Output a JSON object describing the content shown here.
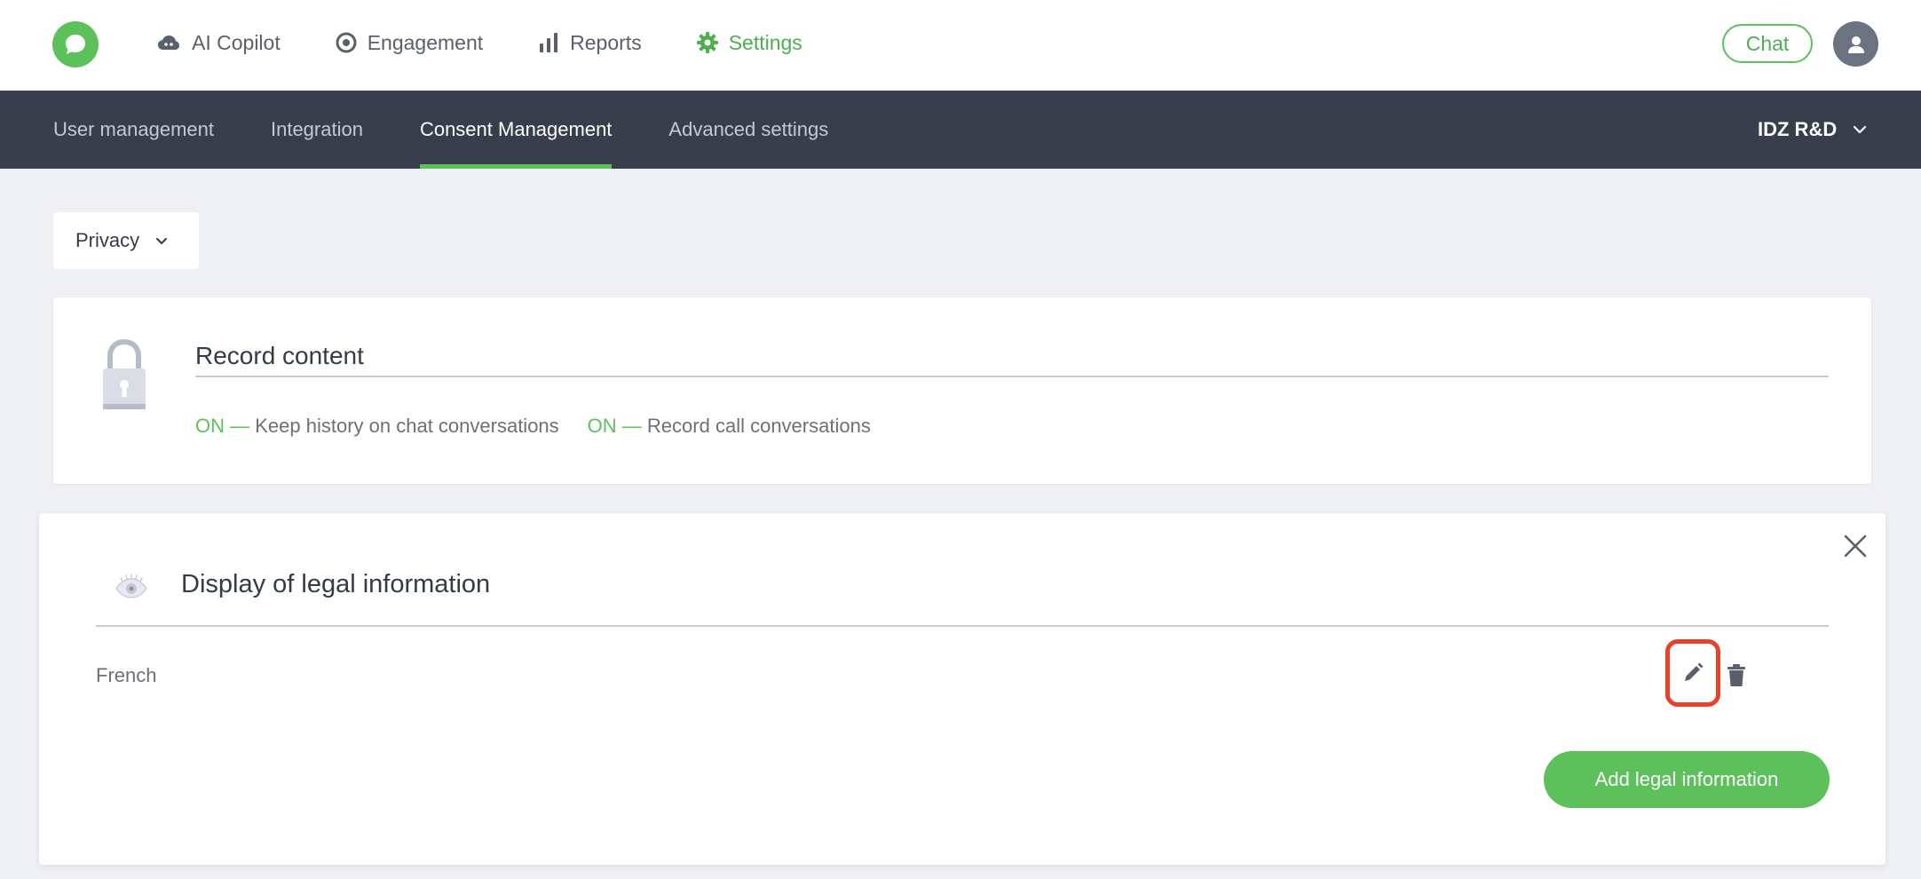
{
  "topnav": {
    "items": [
      {
        "label": "AI Copilot",
        "icon": "cloud-icon"
      },
      {
        "label": "Engagement",
        "icon": "target-icon"
      },
      {
        "label": "Reports",
        "icon": "bar-chart-icon"
      },
      {
        "label": "Settings",
        "icon": "gear-icon",
        "active": true
      }
    ],
    "chat_label": "Chat"
  },
  "subnav": {
    "tabs": [
      {
        "label": "User management"
      },
      {
        "label": "Integration"
      },
      {
        "label": "Consent Management",
        "active": true
      },
      {
        "label": "Advanced settings"
      }
    ],
    "account": "IDZ R&D"
  },
  "privacy_dropdown": {
    "value": "Privacy"
  },
  "record_content": {
    "title": "Record content",
    "options": [
      {
        "status": "ON —",
        "text": "Keep history on chat conversations"
      },
      {
        "status": "ON —",
        "text": "Record call conversations"
      }
    ]
  },
  "legal_info": {
    "title": "Display of legal information",
    "entries": [
      {
        "language": "French"
      }
    ],
    "add_label": "Add legal information"
  },
  "colors": {
    "accent_green": "#5cc15b",
    "subnav_bg": "#383e4b",
    "highlight_red": "#e8402a",
    "page_bg": "#eff0f4"
  }
}
